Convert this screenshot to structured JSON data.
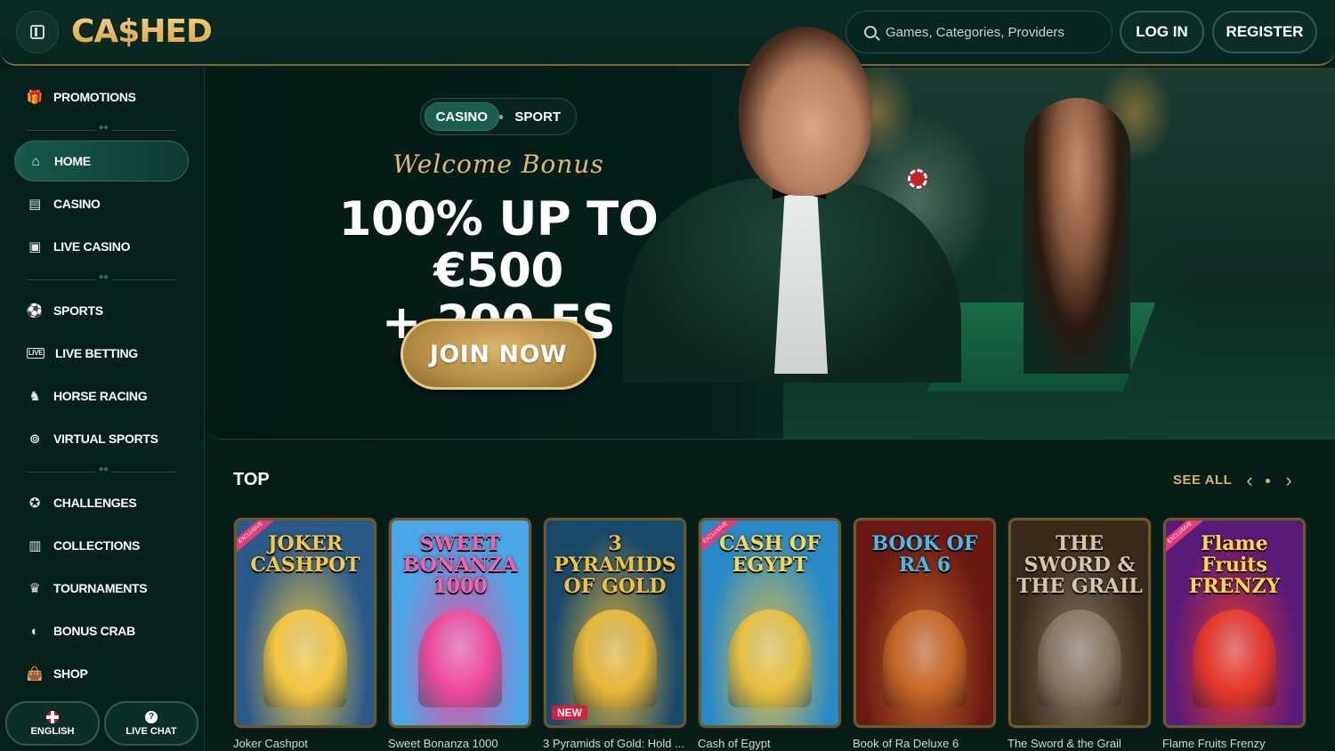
{
  "brand": {
    "logo_text": "CA$HED"
  },
  "header": {
    "search_placeholder": "Games, Categories, Providers",
    "login_label": "LOG IN",
    "register_label": "REGISTER"
  },
  "sidebar": {
    "items": [
      {
        "label": "PROMOTIONS",
        "icon": "gift-icon"
      },
      {
        "label": "HOME",
        "icon": "home-icon",
        "active": true
      },
      {
        "label": "CASINO",
        "icon": "slot-machine-icon"
      },
      {
        "label": "LIVE CASINO",
        "icon": "live-cards-icon"
      },
      {
        "label": "SPORTS",
        "icon": "soccer-ball-icon"
      },
      {
        "label": "LIVE BETTING",
        "icon": "live-tag-icon"
      },
      {
        "label": "HORSE RACING",
        "icon": "horse-icon"
      },
      {
        "label": "VIRTUAL SPORTS",
        "icon": "virtual-ball-icon"
      },
      {
        "label": "CHALLENGES",
        "icon": "medal-icon"
      },
      {
        "label": "COLLECTIONS",
        "icon": "collection-cards-icon"
      },
      {
        "label": "TOURNAMENTS",
        "icon": "trophy-icon"
      },
      {
        "label": "BONUS CRAB",
        "icon": "crab-claw-icon"
      },
      {
        "label": "SHOP",
        "icon": "shopping-bag-icon"
      }
    ],
    "language_label": "ENGLISH",
    "chat_label": "LIVE CHAT"
  },
  "hero": {
    "toggle": {
      "casino": "CASINO",
      "sport": "SPORT",
      "active": "casino"
    },
    "welcome": "Welcome Bonus",
    "headline_line1": "100% UP TO €500",
    "headline_line2": "+ 200 FS",
    "cta": "JOIN NOW"
  },
  "top_section": {
    "title": "TOP",
    "see_all": "SEE ALL",
    "games": [
      {
        "name": "Joker Cashpot",
        "art_title": "JOKER CASHPOT",
        "badge": "EXCLUSIVE",
        "bg": "#2a5a8a",
        "accent": "#f5c842",
        "title_color": "#f5c842"
      },
      {
        "name": "Sweet Bonanza 1000",
        "art_title": "SWEET BONANZA 1000",
        "bg": "#4aa8e8",
        "accent": "#f04a9a",
        "title_color": "#ff5fa8"
      },
      {
        "name": "3 Pyramids of Gold: Hold ...",
        "art_title": "3 PYRAMIDS OF GOLD",
        "new": "NEW",
        "bg": "#1a4a6a",
        "accent": "#e8b83a",
        "title_color": "#f0c040"
      },
      {
        "name": "Cash of Egypt",
        "art_title": "CASH OF EGYPT",
        "badge": "EXCLUSIVE",
        "bg": "#2a8ac8",
        "accent": "#e8c040",
        "title_color": "#ffd84a"
      },
      {
        "name": "Book of Ra Deluxe 6",
        "art_title": "BOOK OF RA 6",
        "bg": "#6a1a12",
        "accent": "#c86a2a",
        "title_color": "#4ab8e8"
      },
      {
        "name": "The Sword & the Grail",
        "art_title": "THE SWORD & THE GRAIL",
        "bg": "#3a2a1a",
        "accent": "#8a7a6a",
        "title_color": "#d4c8a8"
      },
      {
        "name": "Flame Fruits Frenzy",
        "art_title": "Flame Fruits FRENZY",
        "badge": "EXCLUSIVE",
        "bg": "#5a1a7a",
        "accent": "#e83a2a",
        "title_color": "#ffd84a"
      }
    ]
  }
}
